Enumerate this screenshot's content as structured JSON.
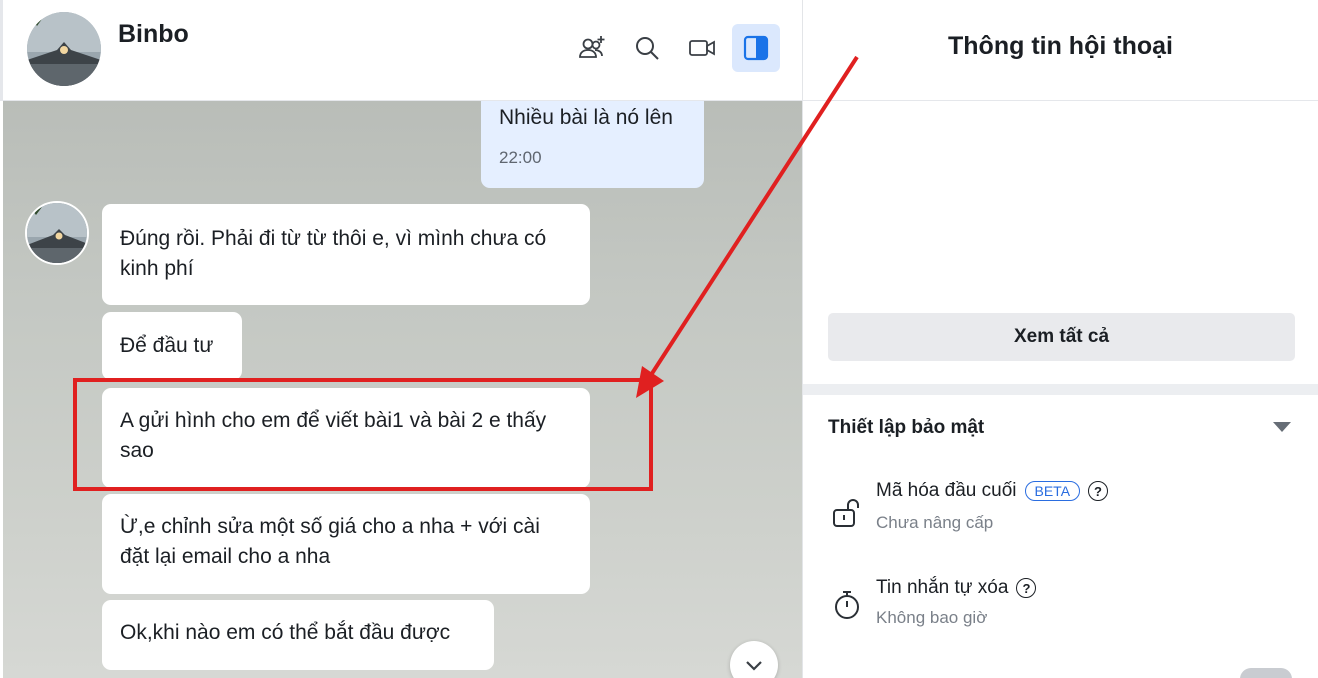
{
  "chat": {
    "name": "Binbo",
    "header_icons": [
      "add-member-icon",
      "search-icon",
      "video-call-icon",
      "info-panel-icon"
    ],
    "messages": [
      {
        "from": "me",
        "text": "Nhiều bài là nó lên",
        "time": "22:00"
      },
      {
        "from": "them",
        "text": "Đúng rồi. Phải đi từ từ thôi e, vì mình chưa có kinh phí"
      },
      {
        "from": "them",
        "text": "Để đầu tư"
      },
      {
        "from": "them",
        "text": "A gửi hình cho em để viết bài1 và bài 2 e thấy sao"
      },
      {
        "from": "them",
        "text": "Ừ,e chỉnh sửa một số giá cho a nha + với cài đặt lại email cho a nha"
      },
      {
        "from": "them",
        "text": "Ok,khi nào em có thể bắt đầu được"
      }
    ]
  },
  "info": {
    "title": "Thông tin hội thoại",
    "view_all_label": "Xem tất cả",
    "security_title": "Thiết lập bảo mật",
    "e2e": {
      "title": "Mã hóa đầu cuối",
      "badge": "BETA",
      "subtitle": "Chưa nâng cấp"
    },
    "auto_delete": {
      "title": "Tin nhắn tự xóa",
      "subtitle": "Không bao giờ"
    }
  },
  "annotation": {
    "highlight_color": "#e02020"
  },
  "colors": {
    "accent": "#2a6de0",
    "my_bubble": "#e5efff"
  }
}
